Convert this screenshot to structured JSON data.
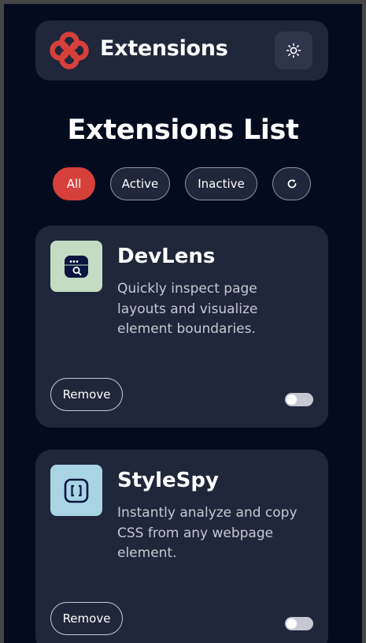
{
  "header": {
    "brand": "Extensions",
    "theme_toggle_icon": "sun-icon"
  },
  "title": "Extensions List",
  "filters": [
    {
      "label": "All",
      "selected": true
    },
    {
      "label": "Active",
      "selected": false
    },
    {
      "label": "Inactive",
      "selected": false
    },
    {
      "label": "",
      "icon": "refresh-icon"
    }
  ],
  "extensions": [
    {
      "name": "DevLens",
      "description": "Quickly inspect page layouts and visualize element boundaries.",
      "icon": "browser-search-icon",
      "icon_bg": "#c4dcc4",
      "remove_label": "Remove",
      "enabled": false
    },
    {
      "name": "StyleSpy",
      "description": "Instantly analyze and copy CSS from any webpage element.",
      "icon": "brackets-icon",
      "icon_bg": "#a9d4e6",
      "remove_label": "Remove",
      "enabled": false
    }
  ],
  "colors": {
    "accent": "#d6403a",
    "background": "#050b1f",
    "surface": "#21273a"
  }
}
